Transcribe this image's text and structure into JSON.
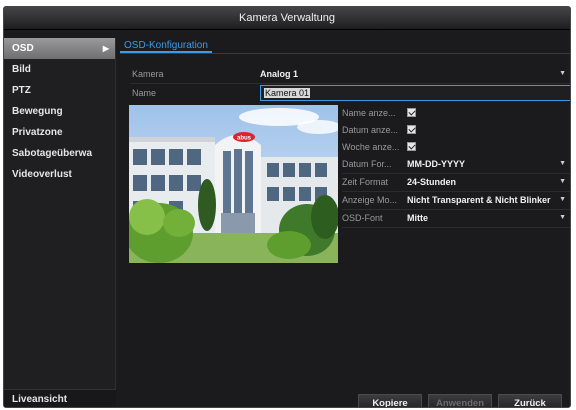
{
  "window": {
    "title": "Kamera Verwaltung"
  },
  "sidebar": {
    "items": [
      {
        "label": "OSD"
      },
      {
        "label": "Bild"
      },
      {
        "label": "PTZ"
      },
      {
        "label": "Bewegung"
      },
      {
        "label": "Privatzone"
      },
      {
        "label": "Sabotageüberwa"
      },
      {
        "label": "Videoverlust"
      }
    ],
    "active_index": 0,
    "footer": "Liveansicht"
  },
  "main": {
    "tab": "OSD-Konfiguration",
    "camera": {
      "label": "Kamera",
      "value": "Analog 1"
    },
    "name": {
      "label": "Name",
      "value": "Kamera 01"
    },
    "settings": [
      {
        "label": "Name anze...",
        "type": "checkbox",
        "checked": true
      },
      {
        "label": "Datum anze...",
        "type": "checkbox",
        "checked": true
      },
      {
        "label": "Woche anze...",
        "type": "checkbox",
        "checked": true
      },
      {
        "label": "Datum For...",
        "type": "select",
        "value": "MM-DD-YYYY"
      },
      {
        "label": "Zeit Format",
        "type": "select",
        "value": "24-Stunden"
      },
      {
        "label": "Anzeige Mo...",
        "type": "select",
        "value": "Nicht Transparent & Nicht Blinker"
      },
      {
        "label": "OSD-Font",
        "type": "select",
        "value": "Mitte"
      }
    ],
    "preview": {
      "logo_text": "abus"
    }
  },
  "buttons": {
    "copy": "Kopiere",
    "apply": "Anwenden",
    "back": "Zurück"
  },
  "colors": {
    "accent": "#3e9ae8",
    "window_bg": "#1b1b1d",
    "active_item": "#8a8a8c"
  }
}
